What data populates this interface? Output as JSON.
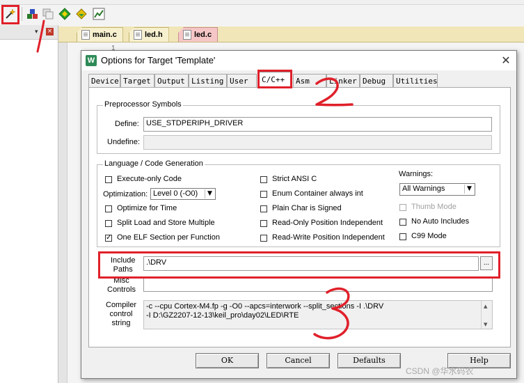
{
  "ide": {
    "tabs": [
      {
        "label": "main.c",
        "active": false
      },
      {
        "label": "led.h",
        "active": false
      },
      {
        "label": "led.c",
        "active": true
      }
    ],
    "line_number": "1",
    "panel_close": "×",
    "panel_pin": "▾"
  },
  "dialog": {
    "title": "Options for Target 'Template'",
    "close": "✕",
    "icon_letter": "W",
    "tabs": [
      "Device",
      "Target",
      "Output",
      "Listing",
      "User",
      "C/C++",
      "Asm",
      "Linker",
      "Debug",
      "Utilities"
    ],
    "active_tab": "C/C++",
    "preprocessor": {
      "group_label": "Preprocessor Symbols",
      "define_label": "Define:",
      "define_value": "USE_STDPERIPH_DRIVER",
      "undefine_label": "Undefine:",
      "undefine_value": ""
    },
    "codegen": {
      "group_label": "Language / Code Generation",
      "execute_only": {
        "label": "Execute-only Code",
        "checked": false
      },
      "optimization_label": "Optimization:",
      "optimization_value": "Level 0 (-O0)",
      "optimize_time": {
        "label": "Optimize for Time",
        "checked": false
      },
      "split_load": {
        "label": "Split Load and Store Multiple",
        "checked": false
      },
      "one_elf": {
        "label": "One ELF Section per Function",
        "checked": true
      },
      "strict_ansi": {
        "label": "Strict ANSI C",
        "checked": false
      },
      "enum_int": {
        "label": "Enum Container always int",
        "checked": false
      },
      "plain_char": {
        "label": "Plain Char is Signed",
        "checked": false
      },
      "ro_pi": {
        "label": "Read-Only Position Independent",
        "checked": false
      },
      "rw_pi": {
        "label": "Read-Write Position Independent",
        "checked": false
      },
      "warnings_label": "Warnings:",
      "warnings_value": "All Warnings",
      "thumb_mode": {
        "label": "Thumb Mode",
        "checked": false,
        "disabled": true
      },
      "no_auto_includes": {
        "label": "No Auto Includes",
        "checked": false
      },
      "c99": {
        "label": "C99 Mode",
        "checked": false
      }
    },
    "include": {
      "label_line1": "Include",
      "label_line2": "Paths",
      "value": ".\\DRV",
      "browse": "..."
    },
    "misc": {
      "label_line1": "Misc",
      "label_line2": "Controls",
      "value": ""
    },
    "compiler": {
      "label_line1": "Compiler",
      "label_line2": "control",
      "label_line3": "string",
      "line1": "-c --cpu Cortex-M4.fp -g -O0 --apcs=interwork --split_sections -I .\\DRV",
      "line2": "-I D:\\GZ2207-12-13\\keil_pro\\day02\\LED\\RTE"
    },
    "buttons": {
      "ok": "OK",
      "cancel": "Cancel",
      "defaults": "Defaults",
      "help": "Help"
    }
  },
  "annotations": {
    "color": "#e0202a",
    "marks": [
      "1",
      "2",
      "3"
    ]
  },
  "watermark": "CSDN @华水码农",
  "colors": {
    "tab_bar": "#f1e6b8",
    "active_file_tab": "#f6c6c6",
    "dialog_bg": "#f0f0f0"
  }
}
